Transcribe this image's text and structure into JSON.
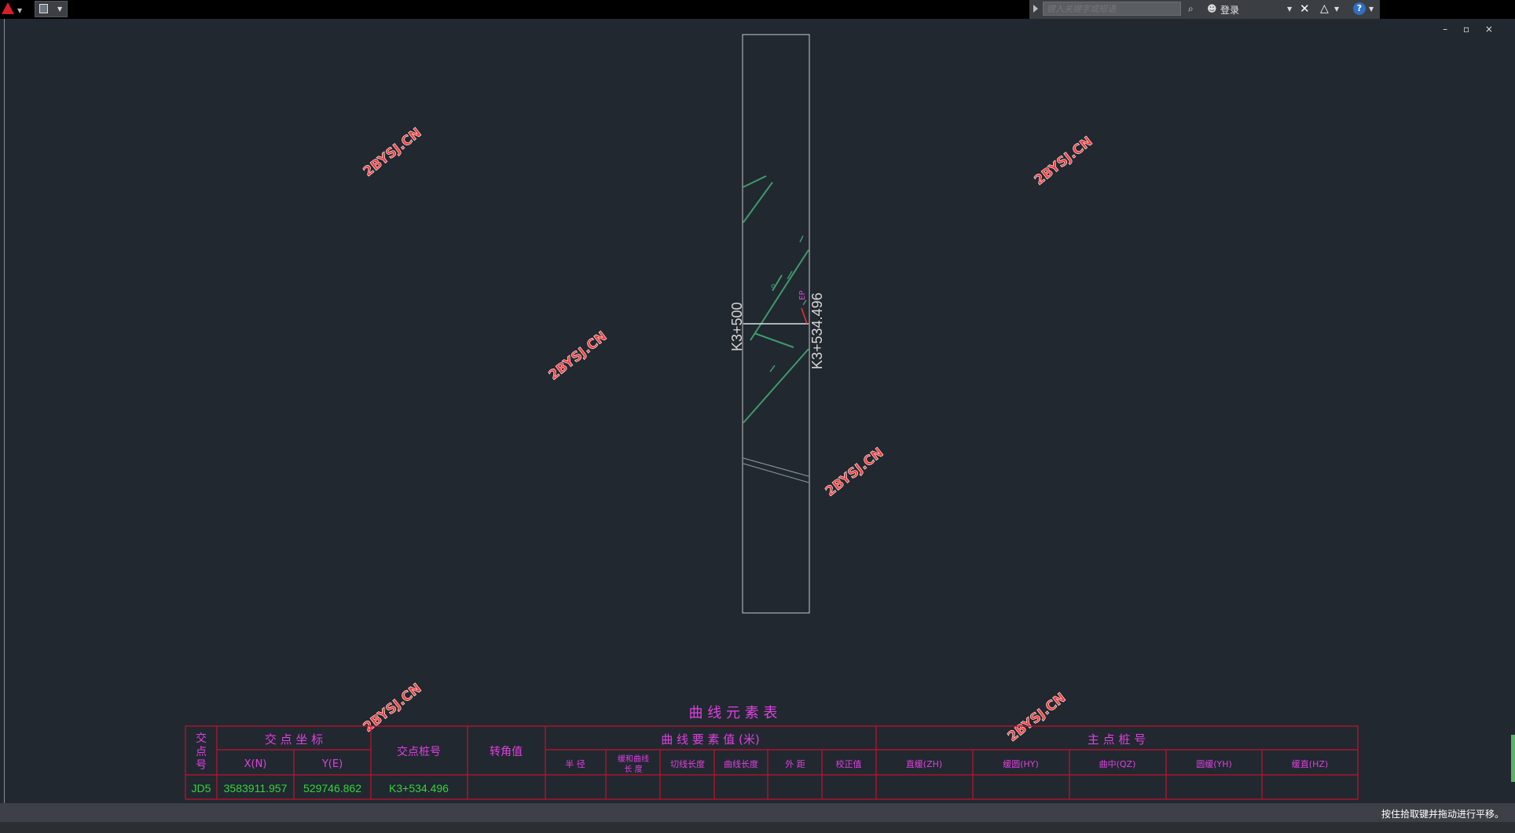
{
  "toolbar": {
    "app_menu": "app-menu",
    "search_placeholder": "键入关键字或短语",
    "login_label": "登录"
  },
  "window": {
    "controls": "– ▫ ×"
  },
  "drawing": {
    "station_left": "K3+500",
    "station_right": "K3+534.496",
    "marker_ep": "EP"
  },
  "watermarks": [
    "2BYSJ.CN",
    "2BYSJ.CN",
    "2BYSJ.CN",
    "2BYSJ.CN",
    "2BYSJ.CN",
    "2BYSJ.CN"
  ],
  "table": {
    "title": "曲 线 元 素 表",
    "headers": {
      "jd_no": [
        "交",
        "点",
        "号"
      ],
      "coords": "交 点 坐 标",
      "x": "X(N)",
      "y": "Y(E)",
      "station": "交点桩号",
      "angle": "转角值",
      "curve_elements": "曲 线 要 素 值 (米)",
      "radius": "半  径",
      "spiral_len": [
        "缓和曲线",
        "长  度"
      ],
      "tangent_len": "切线长度",
      "curve_len": "曲线长度",
      "external": "外  距",
      "correction": "校正值",
      "main_points": "主    点    桩    号",
      "zh": "直缓(ZH)",
      "hy": "缓圆(HY)",
      "qz": "曲中(QZ)",
      "yh": "圆缓(YH)",
      "hz": "缓直(HZ)"
    },
    "rows": [
      {
        "jd": "JD5",
        "x": "3583911.957",
        "y": "529746.862",
        "station": "K3+534.496"
      }
    ]
  },
  "status": {
    "message": "按住拾取键并拖动进行平移。"
  },
  "colors": {
    "background": "#212830",
    "table_line": "#c8102e",
    "header_text": "#e040e0",
    "value_text": "#36d43a",
    "road_line": "#3d9b6a"
  }
}
